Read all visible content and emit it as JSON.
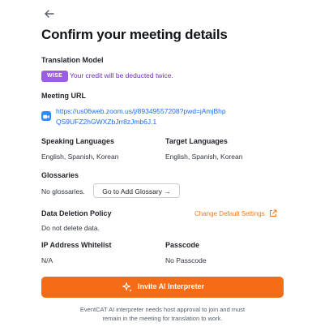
{
  "header": {
    "title": "Confirm your meeting details"
  },
  "translation_model": {
    "label": "Translation Model",
    "badge": "WISE",
    "note": "Your credit will be deducted twice."
  },
  "meeting": {
    "label": "Meeting URL",
    "icon": "zoom-icon",
    "url": "https://us06web.zoom.us/j/89349557208?pwd=jAmjBhpQS9UFZ2hGWXZbJrr8zJmb6J.1"
  },
  "speaking": {
    "label": "Speaking Languages",
    "value": "English, Spanish, Korean"
  },
  "target": {
    "label": "Target Languages",
    "value": "English, Spanish, Korean"
  },
  "glossaries": {
    "label": "Glossaries",
    "value": "No glossaries.",
    "button": "Go to Add Glossary →"
  },
  "deletion": {
    "label": "Data Deletion Policy",
    "value": "Do not delete data.",
    "link": "Change Default Settings"
  },
  "ip": {
    "label": "IP Address Whitelist",
    "value": "N/A"
  },
  "passcode": {
    "label": "Passcode",
    "value": "No Passcode"
  },
  "cta": {
    "label": "Invite AI Interpreter"
  },
  "footer": {
    "line1": "EventCAT AI interpreter needs host approval to join and must",
    "line2": "remain in the meeting for translation to work."
  },
  "colors": {
    "accent": "#f56b16",
    "badge": "#9b5de5",
    "credit_text": "#6f2dbd",
    "link": "#1f6feb",
    "zoom": "#2d8cff"
  }
}
